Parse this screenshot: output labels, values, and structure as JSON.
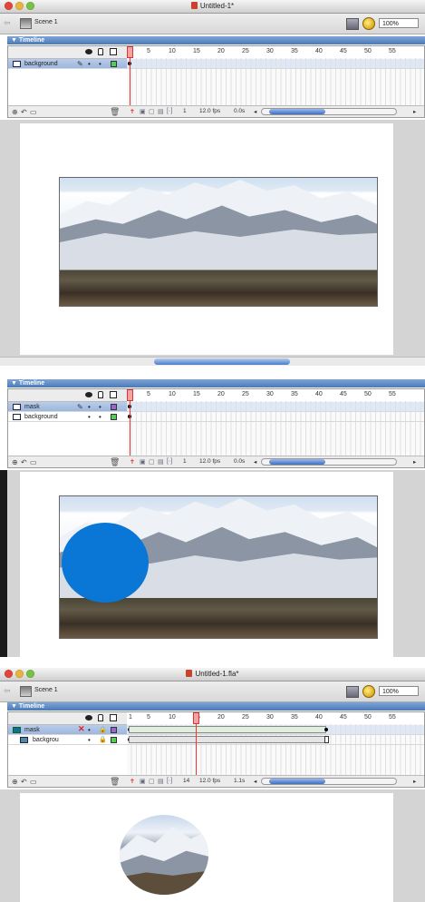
{
  "screens": [
    {
      "window_title": "Untitled-1*",
      "scene_label": "Scene 1",
      "zoom": "100%",
      "timeline_label": "Timeline",
      "layers": [
        {
          "name": "background",
          "icon": "normal",
          "selected": true,
          "swatch": "#55cc55"
        }
      ],
      "ruler": [
        "1",
        "5",
        "10",
        "15",
        "20",
        "25",
        "30",
        "35",
        "40",
        "45",
        "50",
        "55"
      ],
      "status": {
        "frame": "1",
        "fps": "12.0 fps",
        "time": "0.0s"
      }
    },
    {
      "timeline_label": "Timeline",
      "layers": [
        {
          "name": "mask",
          "icon": "normal",
          "selected": true,
          "swatch": "#9966cc"
        },
        {
          "name": "background",
          "icon": "normal",
          "selected": false,
          "swatch": "#55cc55"
        }
      ],
      "ruler": [
        "1",
        "5",
        "10",
        "15",
        "20",
        "25",
        "30",
        "35",
        "40",
        "45",
        "50",
        "55"
      ],
      "status": {
        "frame": "1",
        "fps": "12.0 fps",
        "time": "0.0s"
      }
    },
    {
      "window_title": "Untitled-1.fla*",
      "scene_label": "Scene 1",
      "zoom": "100%",
      "timeline_label": "Timeline",
      "layers": [
        {
          "name": "mask",
          "icon": "mask",
          "selected": true,
          "swatch": "#9966cc"
        },
        {
          "name": "backgrou",
          "icon": "masked",
          "selected": false,
          "swatch": "#55cc55"
        }
      ],
      "ruler": [
        "1",
        "5",
        "10",
        "15",
        "20",
        "25",
        "30",
        "35",
        "40",
        "45",
        "50",
        "55"
      ],
      "status": {
        "frame": "14",
        "fps": "12.0 fps",
        "time": "1.1s"
      }
    }
  ],
  "colors": {
    "accent": "#4b7ab8",
    "playhead": "#e33333",
    "mask_circle": "#0a77d6"
  },
  "icons": {
    "eye": "eye-icon",
    "lock": "lock-icon",
    "outline": "outline-icon",
    "pencil": "pencil-icon",
    "trash": "trash-icon",
    "mask_x": "red-x-icon"
  }
}
